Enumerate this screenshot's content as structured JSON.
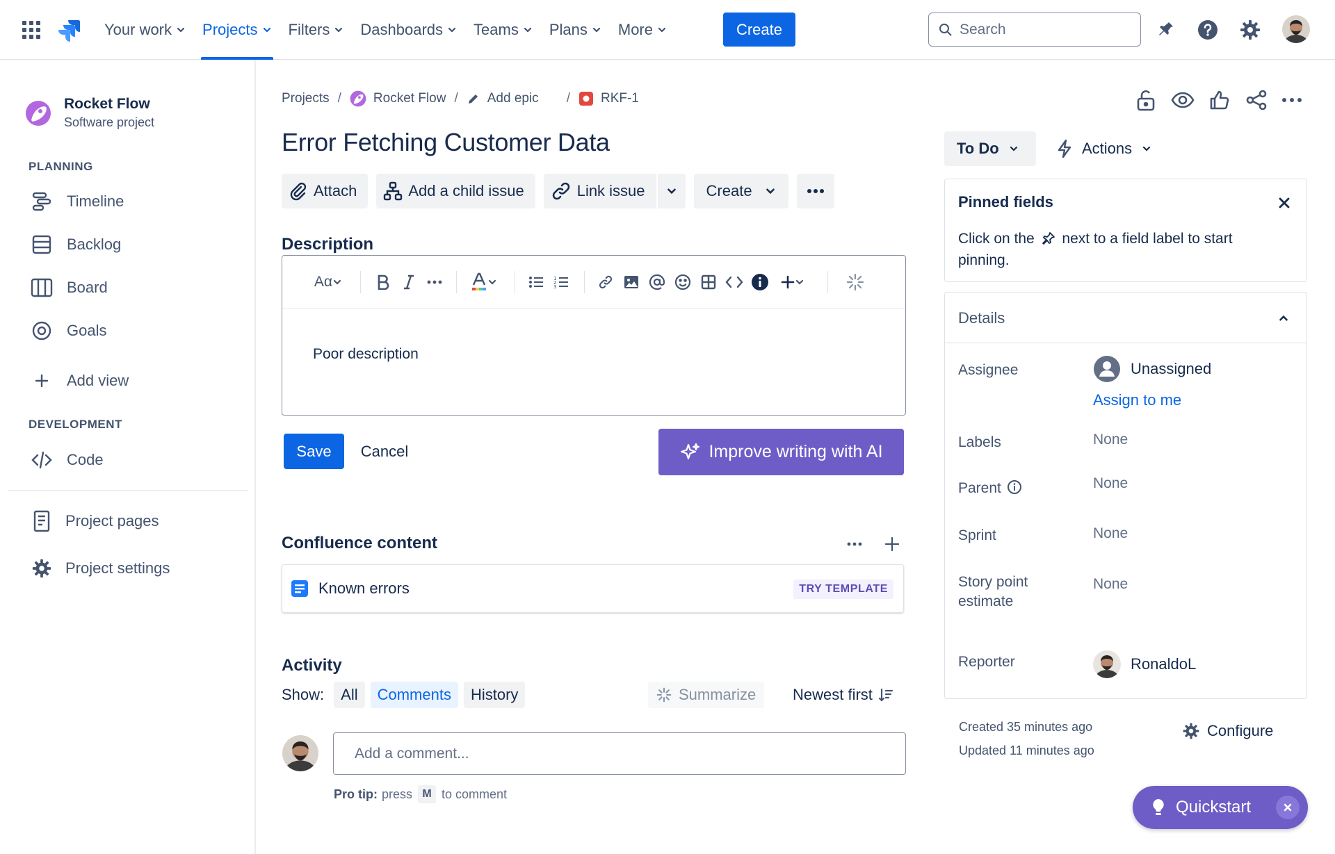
{
  "topnav": {
    "items": [
      {
        "label": "Your work"
      },
      {
        "label": "Projects"
      },
      {
        "label": "Filters"
      },
      {
        "label": "Dashboards"
      },
      {
        "label": "Teams"
      },
      {
        "label": "Plans"
      },
      {
        "label": "More"
      }
    ],
    "active": "Projects",
    "create_label": "Create",
    "search_placeholder": "Search",
    "accent_color": "#0c66e4"
  },
  "sidebar": {
    "project_name": "Rocket Flow",
    "project_type": "Software project",
    "planning_heading": "PLANNING",
    "planning_items": [
      {
        "label": "Timeline",
        "icon": "timeline-icon"
      },
      {
        "label": "Backlog",
        "icon": "backlog-icon"
      },
      {
        "label": "Board",
        "icon": "board-icon"
      },
      {
        "label": "Goals",
        "icon": "goals-icon"
      }
    ],
    "add_view_label": "Add view",
    "development_heading": "DEVELOPMENT",
    "code_label": "Code",
    "project_pages_label": "Project pages",
    "project_settings_label": "Project settings"
  },
  "breadcrumb": {
    "projects": "Projects",
    "project": "Rocket Flow",
    "epic": "Add epic",
    "issue_key": "RKF-1"
  },
  "issue": {
    "title": "Error Fetching Customer Data",
    "actions": {
      "attach": "Attach",
      "add_child": "Add a child issue",
      "link_issue": "Link issue",
      "create": "Create"
    },
    "description_label": "Description",
    "description_toolbar": {
      "text_style": "Aα"
    },
    "description_text": "Poor description",
    "save_label": "Save",
    "cancel_label": "Cancel",
    "ai_label": "Improve writing with AI"
  },
  "confluence": {
    "heading": "Confluence content",
    "card_title": "Known errors",
    "card_action": "TRY TEMPLATE"
  },
  "activity": {
    "heading": "Activity",
    "show_label": "Show:",
    "filters": [
      "All",
      "Comments",
      "History"
    ],
    "active_filter": "Comments",
    "summarize_label": "Summarize",
    "sort_label": "Newest first",
    "comment_placeholder": "Add a comment...",
    "protip_bold": "Pro tip:",
    "protip_press": "press",
    "protip_key": "M",
    "protip_rest": "to comment"
  },
  "right_panel": {
    "status": "To Do",
    "actions_label": "Actions",
    "pinned_title": "Pinned fields",
    "pinned_text_before": "Click on the",
    "pinned_text_after": "next to a field label to start pinning.",
    "details_title": "Details",
    "fields": {
      "assignee_label": "Assignee",
      "assignee_value": "Unassigned",
      "assign_to_me": "Assign to me",
      "labels_label": "Labels",
      "labels_value": "None",
      "parent_label": "Parent",
      "parent_value": "None",
      "sprint_label": "Sprint",
      "sprint_value": "None",
      "story_points_label": "Story point estimate",
      "story_points_value": "None",
      "reporter_label": "Reporter",
      "reporter_value": "RonaldoL"
    },
    "created": "Created 35 minutes ago",
    "updated": "Updated 11 minutes ago",
    "configure_label": "Configure"
  },
  "quickstart": {
    "label": "Quickstart",
    "color": "#6e5dc6"
  }
}
